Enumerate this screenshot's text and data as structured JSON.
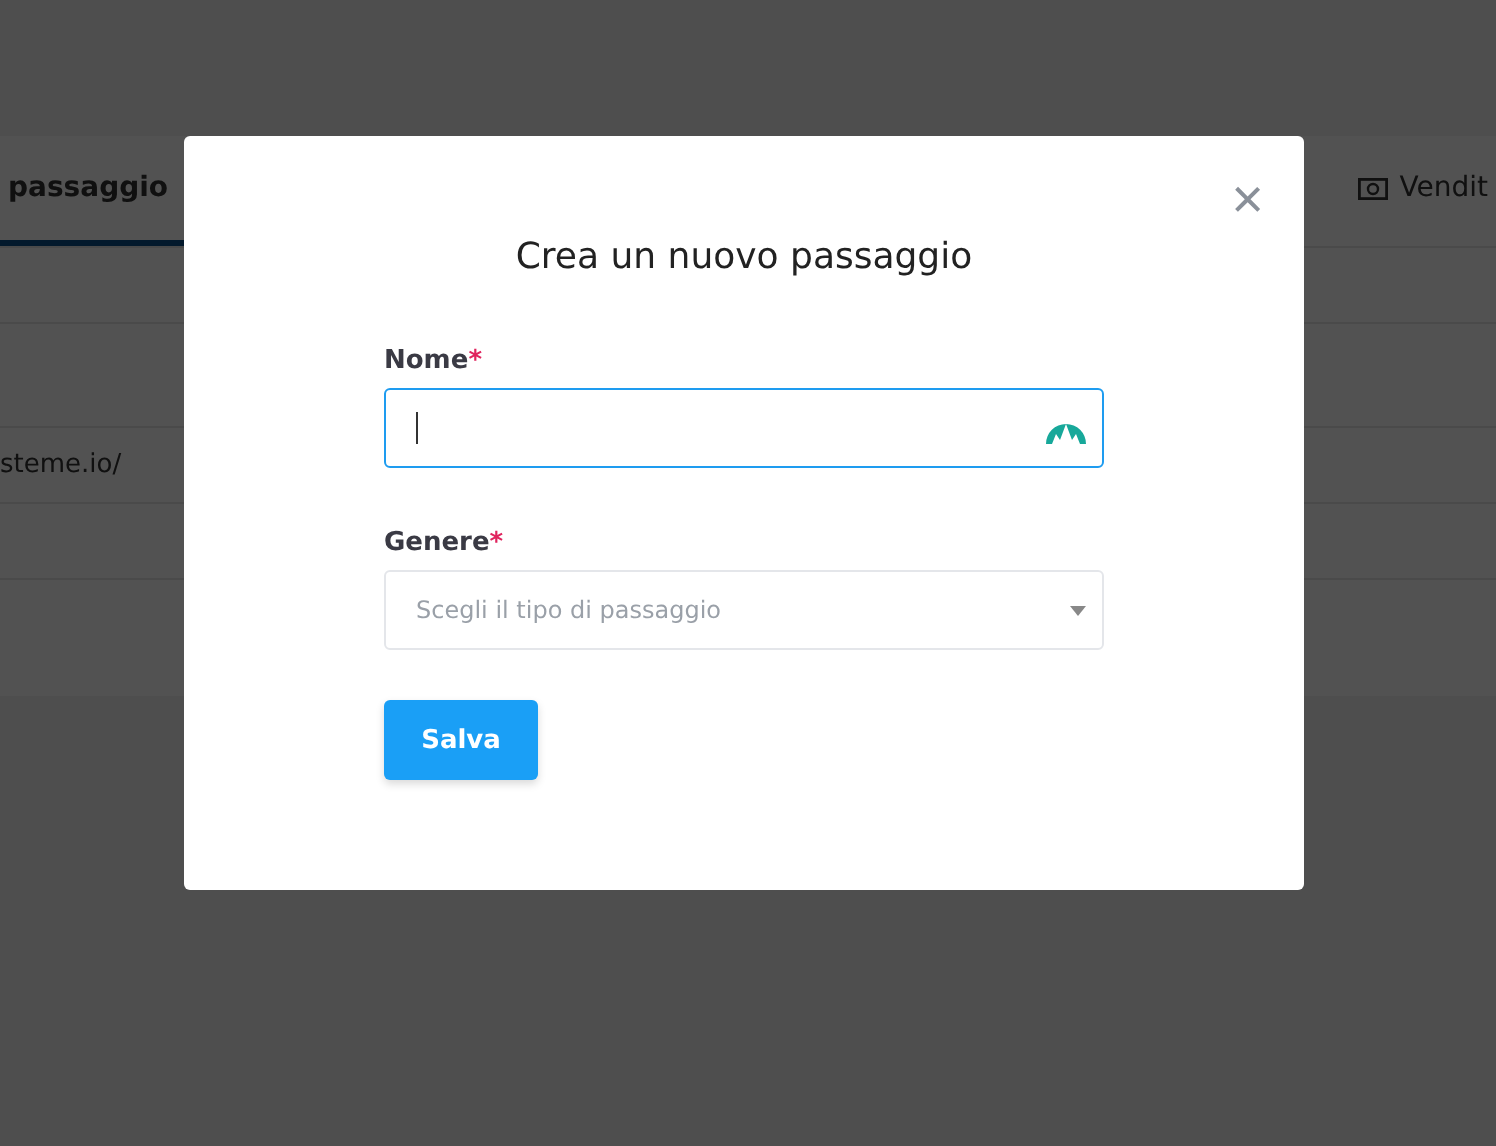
{
  "background_page": {
    "tabs": [
      {
        "label": "passaggio",
        "selected": true
      },
      {
        "label": "Vendit",
        "selected": false
      }
    ],
    "table": {
      "rows": [
        {},
        {},
        {
          "cell": "steme.io/"
        },
        {}
      ]
    }
  },
  "modal": {
    "title": "Crea un nuovo passaggio",
    "close": "×",
    "fields": [
      {
        "kind": "text",
        "label": "Nome",
        "required_mark": "*",
        "focused": true
      },
      {
        "kind": "select",
        "label": "Genere",
        "required_mark": "*",
        "placeholder": "Scegli il tipo di passaggio",
        "focused": false
      }
    ],
    "button": "Salva"
  }
}
